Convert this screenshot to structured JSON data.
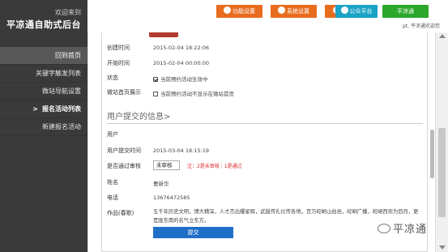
{
  "sidebar": {
    "welcome": "欢迎来到",
    "app_name": "平凉通自助式后台",
    "items": [
      {
        "label": "回到首页"
      },
      {
        "label": "关键字触发列表"
      },
      {
        "label": "微站导航设置"
      },
      {
        "label": "报名活动列表",
        "arrow": ">"
      },
      {
        "label": "新建报名活动"
      }
    ]
  },
  "topbar": {
    "buttons": [
      {
        "label": "功能设置"
      },
      {
        "label": "系统设置"
      },
      {
        "label": "使用"
      },
      {
        "label": "公众平台"
      },
      {
        "label": "平凉通"
      }
    ],
    "user_line": "pt, 平凉通欢迎您"
  },
  "form": {
    "created_label": "创建时间",
    "created_value": "2015-02-04 18:22:06",
    "start_label": "开始时间",
    "start_value": "2015-02-04 00:00:00",
    "status_label": "状态",
    "status_value": "当前预约活动生效中",
    "status_checked": true,
    "homepage_label": "微站首页展示",
    "homepage_value": "当前预约活动不显示在微站首页",
    "homepage_checked": false,
    "section_title": "用户提交的信息>",
    "user_label": "用户",
    "submit_time_label": "用户提交时间",
    "submit_time_value": "2015-03-04 18:15:19",
    "approved_label": "是否通过审核",
    "approved_select": "未审核",
    "approved_note": "注：2是未审核｜1是通过",
    "name_label": "姓名",
    "name_value": "曹新华",
    "phone_label": "电话",
    "phone_value": "13676472585",
    "works_label": "作品(春歌)",
    "works_value": "五千年历史文明，博大精深，人才杰出耀星辉，武鼓传礼仪传各地，百万崆峒山伯邑，崆峒广播，崆峒西坝为目月，更是陇东南的名气立东方。",
    "submit_button": "提交"
  },
  "watermark": "平凉通",
  "colors": {
    "sidebar_bg": "#3a3a3a",
    "orange_button": "#e86c1e",
    "teal_button": "#1aa3c5",
    "green_button": "#2ba82b",
    "submit_blue": "#1f6fc8",
    "note_red": "#e02020"
  }
}
